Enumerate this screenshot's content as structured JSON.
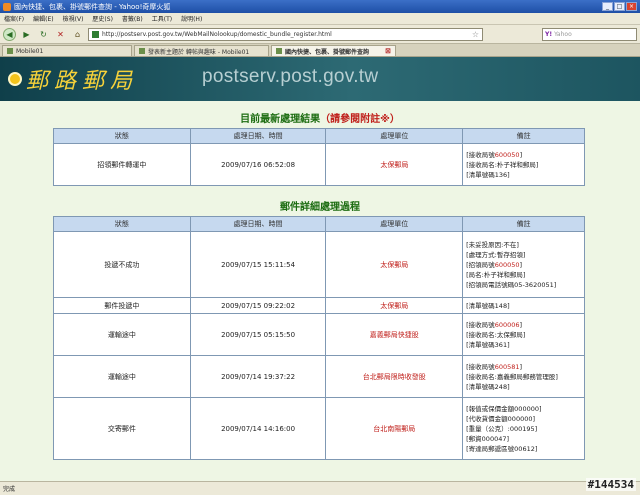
{
  "window": {
    "title": "國內快捷、包裹、掛號郵件查詢 - Yahoo!奇摩火狐"
  },
  "menu": [
    "檔案(F)",
    "編輯(E)",
    "檢視(V)",
    "歷史(S)",
    "書籤(B)",
    "工具(T)",
    "說明(H)"
  ],
  "nav": {
    "url": "http://postserv.post.gov.tw/WebMailNolookup/domestic_bundle_register.html",
    "search_placeholder": "Yahoo"
  },
  "tabs": [
    {
      "label": "Mobile01"
    },
    {
      "label": "發表新主題於 轉帖與趣味 - Mobile01"
    },
    {
      "label": "國內快捷、包裹、掛號郵件查詢"
    }
  ],
  "banner": {
    "logo": "郵路郵局",
    "domain": "postserv.post.gov.tw"
  },
  "latest": {
    "title": "目前最新處理結果",
    "note": "（請參閱附註※）",
    "headers": [
      "狀態",
      "處理日期、時間",
      "處理單位",
      "備註"
    ],
    "row": {
      "status": "招領郵件轉運中",
      "datetime": "2009/07/16 06:52:08",
      "unit": "太保郵局",
      "notes": [
        {
          "label": "[接收局號",
          "code": "600050",
          "tail": "]"
        },
        {
          "label": "[接收局名:朴子祥和郵局]",
          "code": "",
          "tail": ""
        },
        {
          "label": "[清單號碼136]",
          "code": "",
          "tail": ""
        }
      ]
    }
  },
  "detail": {
    "title": "郵件詳細處理過程",
    "headers": [
      "狀態",
      "處理日期、時間",
      "處理單位",
      "備註"
    ],
    "rows": [
      {
        "status": "投遞不成功",
        "datetime": "2009/07/15 15:11:54",
        "unit": "太保郵局",
        "notes": [
          {
            "label": "[未妥投原因:不在]",
            "code": "",
            "tail": ""
          },
          {
            "label": "[處理方式:暫存招領]",
            "code": "",
            "tail": ""
          },
          {
            "label": "[招領局號",
            "code": "600050",
            "tail": "]"
          },
          {
            "label": "[局名:朴子祥和郵局]",
            "code": "",
            "tail": ""
          },
          {
            "label": "[招領局電話號碼05-3620051]",
            "code": "",
            "tail": ""
          }
        ]
      },
      {
        "status": "郵件投遞中",
        "datetime": "2009/07/15 09:22:02",
        "unit": "太保郵局",
        "notes": [
          {
            "label": "[清單號碼148]",
            "code": "",
            "tail": ""
          }
        ]
      },
      {
        "status": "運輸途中",
        "datetime": "2009/07/15 05:15:50",
        "unit": "嘉義郵局快捷股",
        "notes": [
          {
            "label": "[接收局號",
            "code": "600006",
            "tail": "]"
          },
          {
            "label": "[接收局名:太保郵局]",
            "code": "",
            "tail": ""
          },
          {
            "label": "[清單號碼361]",
            "code": "",
            "tail": ""
          }
        ]
      },
      {
        "status": "運輸途中",
        "datetime": "2009/07/14 19:37:22",
        "unit": "台北郵局限時收發股",
        "notes": [
          {
            "label": "[接收局號",
            "code": "600581",
            "tail": "]"
          },
          {
            "label": "[接收局名:嘉義郵局郵務管理股]",
            "code": "",
            "tail": ""
          },
          {
            "label": "[清單號碼248]",
            "code": "",
            "tail": ""
          }
        ]
      },
      {
        "status": "交寄郵件",
        "datetime": "2009/07/14 14:16:00",
        "unit": "台北南陽郵局",
        "notes": [
          {
            "label": "[報值或保價金額000000]",
            "code": "",
            "tail": ""
          },
          {
            "label": "[代收貨價金額000000]",
            "code": "",
            "tail": ""
          },
          {
            "label": "[重量（公克）:000195]",
            "code": "",
            "tail": ""
          },
          {
            "label": "[郵資000047]",
            "code": "",
            "tail": ""
          },
          {
            "label": "[寄達局郵遞區號00612]",
            "code": "",
            "tail": ""
          }
        ]
      }
    ]
  },
  "status": {
    "text": "完成"
  },
  "watermark": "#144534"
}
